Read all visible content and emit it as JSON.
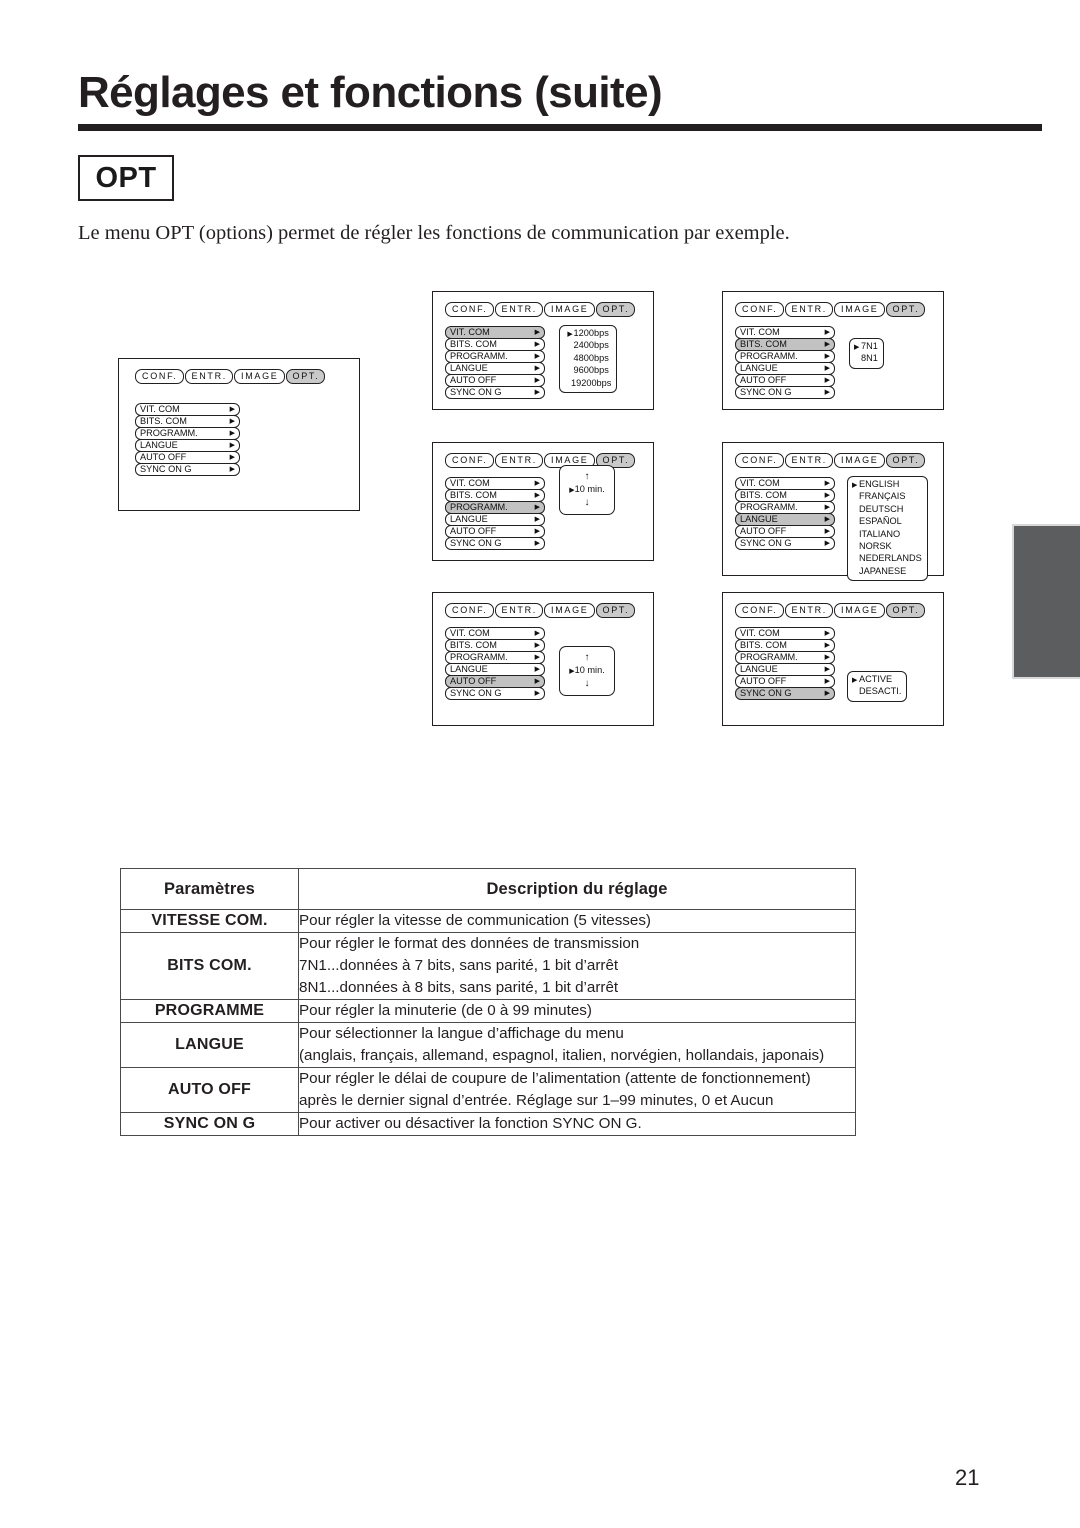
{
  "page": {
    "title": "Réglages et fonctions (suite)",
    "badge": "OPT",
    "intro": "Le menu OPT (options) permet de régler les fonctions de communication par exemple.",
    "number": "21"
  },
  "osd": {
    "tabs": [
      "CONF.",
      "ENTR.",
      "IMAGE",
      "OPT."
    ],
    "selected_tab": "OPT.",
    "menu_items": [
      "VIT. COM",
      "BITS. COM",
      "PROGRAMM.",
      "LANGUE",
      "AUTO OFF",
      "SYNC ON G"
    ],
    "arrow_glyph": "▶",
    "panels": [
      {
        "id": "panel-overview",
        "highlighted_item": null,
        "popup": null
      },
      {
        "id": "panel-vit-com",
        "highlighted_item": "VIT. COM",
        "popup": {
          "type": "list",
          "selected": "1200bps",
          "options": [
            "1200bps",
            "2400bps",
            "4800bps",
            "9600bps",
            "19200bps"
          ]
        }
      },
      {
        "id": "panel-bits-com",
        "highlighted_item": "BITS. COM",
        "popup": {
          "type": "list",
          "selected": "7N1",
          "options": [
            "7N1",
            "8N1"
          ]
        }
      },
      {
        "id": "panel-programm",
        "highlighted_item": "PROGRAMM.",
        "popup": {
          "type": "stepper",
          "up": "↑",
          "down": "↓",
          "value": "10  min."
        }
      },
      {
        "id": "panel-langue",
        "highlighted_item": "LANGUE",
        "popup": {
          "type": "list",
          "selected": "ENGLISH",
          "options": [
            "ENGLISH",
            "FRANÇAIS",
            "DEUTSCH",
            "ESPAÑOL",
            "ITALIANO",
            "NORSK",
            "NEDERLANDS",
            "JAPANESE"
          ]
        }
      },
      {
        "id": "panel-auto-off",
        "highlighted_item": "AUTO OFF",
        "popup": {
          "type": "stepper",
          "up": "↑",
          "down": "↓",
          "value": "10  min."
        }
      },
      {
        "id": "panel-sync-on-g",
        "highlighted_item": "SYNC ON G",
        "popup": {
          "type": "list",
          "selected": "ACTIVE",
          "options": [
            "ACTIVE",
            "DESACTI."
          ]
        }
      }
    ]
  },
  "table": {
    "headers": [
      "Paramètres",
      "Description du réglage"
    ],
    "rows": [
      {
        "param": "VITESSE COM.",
        "lines": [
          "Pour régler la vitesse de communication (5 vitesses)"
        ]
      },
      {
        "param": "BITS COM.",
        "lines": [
          "Pour régler le format des données de transmission",
          "7N1...données à 7 bits, sans parité, 1 bit d’arrêt",
          "8N1...données à 8 bits, sans parité, 1 bit d’arrêt"
        ]
      },
      {
        "param": "PROGRAMME",
        "lines": [
          "Pour régler la minuterie (de 0 à 99 minutes)"
        ]
      },
      {
        "param": "LANGUE",
        "lines": [
          "Pour sélectionner la langue d’affichage du menu",
          "(anglais, français, allemand, espagnol, italien, norvégien, hollandais, japonais)"
        ]
      },
      {
        "param": "AUTO OFF",
        "lines": [
          "Pour régler le délai de coupure de l’alimentation (attente de fonctionnement)",
          "après le dernier signal d’entrée. Réglage sur 1–99 minutes, 0 et Aucun"
        ]
      },
      {
        "param": "SYNC ON G",
        "lines": [
          "Pour activer ou désactiver la fonction SYNC ON G."
        ]
      }
    ]
  },
  "colors": {
    "ink": "#231f20",
    "tab_gray": "#5b5d5f",
    "highlight_gray": "#c2c2c2"
  }
}
